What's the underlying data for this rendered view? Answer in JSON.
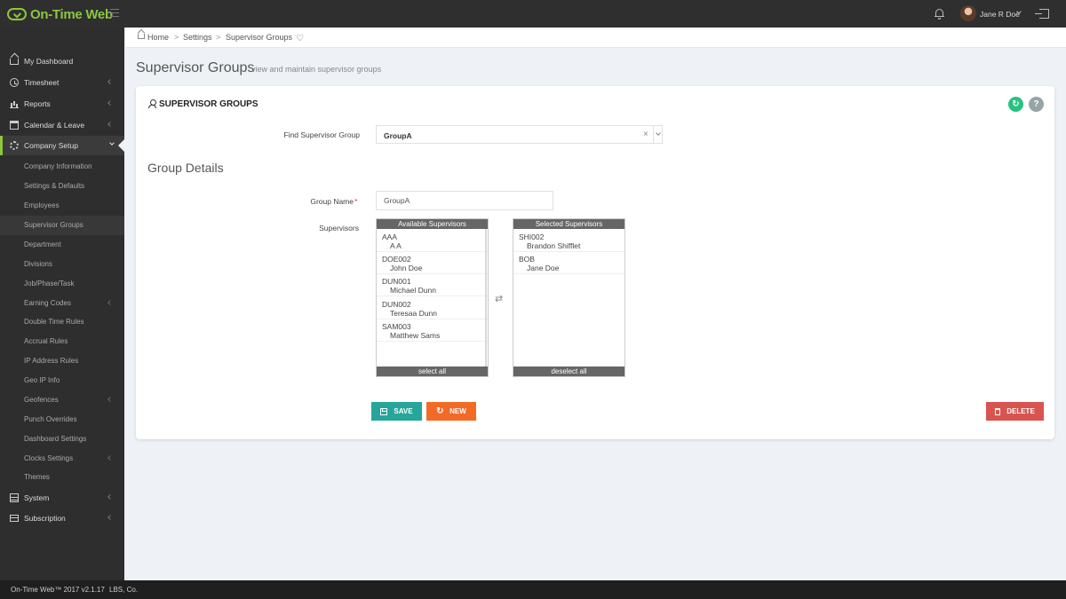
{
  "app": {
    "logo_text": "On-Time Web",
    "user_name": "Jane R Doe"
  },
  "sidebar": {
    "top_items": [
      {
        "label": "My Dashboard",
        "icon": "home-icon"
      },
      {
        "label": "Timesheet",
        "icon": "clock-icon"
      },
      {
        "label": "Reports",
        "icon": "bar-chart-icon"
      },
      {
        "label": "Calendar & Leave",
        "icon": "calendar-icon"
      },
      {
        "label": "Company Setup",
        "icon": "cogs-icon"
      }
    ],
    "sub_items": [
      {
        "label": "Company Information"
      },
      {
        "label": "Settings & Defaults"
      },
      {
        "label": "Employees"
      },
      {
        "label": "Supervisor Groups"
      },
      {
        "label": "Department"
      },
      {
        "label": "Divisions"
      },
      {
        "label": "Job/Phase/Task"
      },
      {
        "label": "Earning Codes"
      },
      {
        "label": "Double Time Rules"
      },
      {
        "label": "Accrual Rules"
      },
      {
        "label": "IP Address Rules"
      },
      {
        "label": "Geo IP Info"
      },
      {
        "label": "Geofences"
      },
      {
        "label": "Punch Overrides"
      },
      {
        "label": "Dashboard Settings"
      },
      {
        "label": "Clocks Settings"
      },
      {
        "label": "Themes"
      }
    ],
    "bottom_items": [
      {
        "label": "System",
        "icon": "server-icon"
      },
      {
        "label": "Subscription",
        "icon": "credit-card-icon"
      }
    ]
  },
  "breadcrumb": {
    "items": [
      "Home",
      "Settings",
      "Supervisor Groups"
    ],
    "separator": ">"
  },
  "page": {
    "title": "Supervisor Groups",
    "subtitle": "view and maintain supervisor groups"
  },
  "portlet": {
    "title": "SUPERVISOR GROUPS",
    "help_glyph": "?"
  },
  "find": {
    "label": "Find Supervisor Group",
    "value": "GroupA",
    "clear_glyph": "×"
  },
  "details": {
    "title": "Group Details",
    "name_label": "Group Name",
    "required_mark": "*",
    "name_value": "GroupA",
    "supervisors_label": "Supervisors"
  },
  "available": {
    "header": "Available Supervisors",
    "footer": "select all",
    "options": [
      {
        "code": "AAA",
        "name": "A A"
      },
      {
        "code": "DOE002",
        "name": "John Doe"
      },
      {
        "code": "DUN001",
        "name": "Michael Dunn"
      },
      {
        "code": "DUN002",
        "name": "Teresaa Dunn"
      },
      {
        "code": "SAM003",
        "name": "Matthew Sams"
      }
    ]
  },
  "selected": {
    "header": "Selected Supervisors",
    "footer": "deselect all",
    "options": [
      {
        "code": "SHI002",
        "name": "Brandon Shifflet"
      },
      {
        "code": "BOB",
        "name": "Jane Doe"
      }
    ]
  },
  "transfer_glyph": "⇄",
  "buttons": {
    "save": "SAVE",
    "new": "NEW",
    "delete": "DELETE"
  },
  "footer": {
    "product": "On-Time Web™ 2017 v2.1.17",
    "company": "LBS, Co."
  },
  "colors": {
    "brand_green": "#8cc63f",
    "save": "#26a69a",
    "new": "#f36a27",
    "delete": "#d9534f",
    "refresh": "#26c281"
  }
}
